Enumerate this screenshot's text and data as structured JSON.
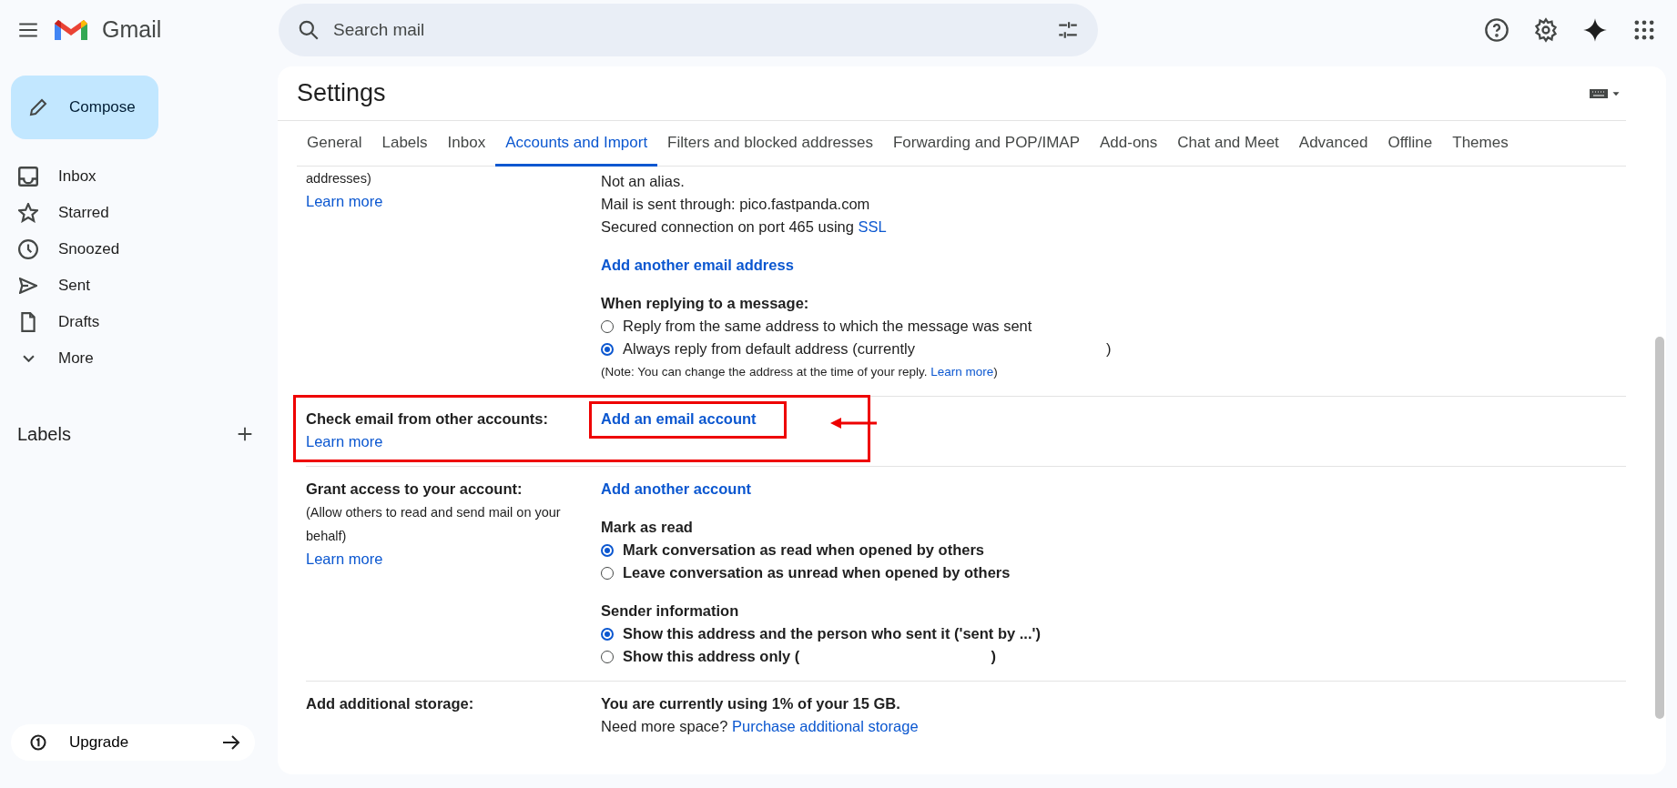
{
  "app": {
    "name": "Gmail"
  },
  "search": {
    "placeholder": "Search mail"
  },
  "compose": {
    "label": "Compose"
  },
  "nav": [
    {
      "label": "Inbox"
    },
    {
      "label": "Starred"
    },
    {
      "label": "Snoozed"
    },
    {
      "label": "Sent"
    },
    {
      "label": "Drafts"
    },
    {
      "label": "More"
    }
  ],
  "labels_heading": "Labels",
  "upgrade": {
    "label": "Upgrade"
  },
  "settings": {
    "title": "Settings",
    "tabs": [
      {
        "label": "General",
        "selected": false
      },
      {
        "label": "Labels",
        "selected": false
      },
      {
        "label": "Inbox",
        "selected": false
      },
      {
        "label": "Accounts and Import",
        "selected": true
      },
      {
        "label": "Filters and blocked addresses",
        "selected": false
      },
      {
        "label": "Forwarding and POP/IMAP",
        "selected": false
      },
      {
        "label": "Add-ons",
        "selected": false
      },
      {
        "label": "Chat and Meet",
        "selected": false
      },
      {
        "label": "Advanced",
        "selected": false
      },
      {
        "label": "Offline",
        "selected": false
      },
      {
        "label": "Themes",
        "selected": false
      }
    ],
    "sections": [
      {
        "description": "addresses)",
        "learn_more": "Learn more",
        "highlighted": false,
        "groups": [
          [
            {
              "kind": "text",
              "text": "Not an alias."
            },
            {
              "kind": "text",
              "text": "Mail is sent through: pico.fastpanda.com"
            },
            {
              "kind": "text",
              "text": "Secured connection on port 465 using",
              "link": "SSL"
            }
          ],
          [
            {
              "kind": "action",
              "text": "Add another email address",
              "highlighted": false
            }
          ],
          [
            {
              "kind": "heading",
              "text": "When replying to a message:"
            },
            {
              "kind": "radio",
              "text": "Reply from the same address to which the message was sent",
              "selected": false,
              "bold": false
            },
            {
              "kind": "radio",
              "text": "Always reply from default address (currently",
              "suffix": ")",
              "selected": true,
              "bold": false
            },
            {
              "kind": "note",
              "text": "(Note: You can change the address at the time of your reply.",
              "link": "Learn more",
              "after": ")"
            }
          ]
        ]
      },
      {
        "label": "Check email from other accounts:",
        "learn_more": "Learn more",
        "highlighted": true,
        "groups": [
          [
            {
              "kind": "action",
              "text": "Add an email account",
              "highlighted": true
            }
          ]
        ]
      },
      {
        "label": "Grant access to your account:",
        "description": "(Allow others to read and send mail on your behalf)",
        "learn_more": "Learn more",
        "highlighted": false,
        "groups": [
          [
            {
              "kind": "action",
              "text": "Add another account",
              "highlighted": false
            }
          ],
          [
            {
              "kind": "heading",
              "text": "Mark as read"
            },
            {
              "kind": "radio",
              "text": "Mark conversation as read when opened by others",
              "selected": true,
              "bold": true
            },
            {
              "kind": "radio",
              "text": "Leave conversation as unread when opened by others",
              "selected": false,
              "bold": true
            }
          ],
          [
            {
              "kind": "heading",
              "text": "Sender information"
            },
            {
              "kind": "radio",
              "text": "Show this address and the person who sent it ('sent by ...')",
              "selected": true,
              "bold": true
            },
            {
              "kind": "radio",
              "text": "Show this address only (",
              "suffix": ")",
              "selected": false,
              "bold": true
            }
          ]
        ]
      },
      {
        "label": "Add additional storage:",
        "highlighted": false,
        "groups": [
          [
            {
              "kind": "heading",
              "text": "You are currently using 1% of your 15 GB."
            },
            {
              "kind": "text",
              "text": "Need more space?",
              "link": "Purchase additional storage"
            }
          ]
        ]
      }
    ]
  }
}
